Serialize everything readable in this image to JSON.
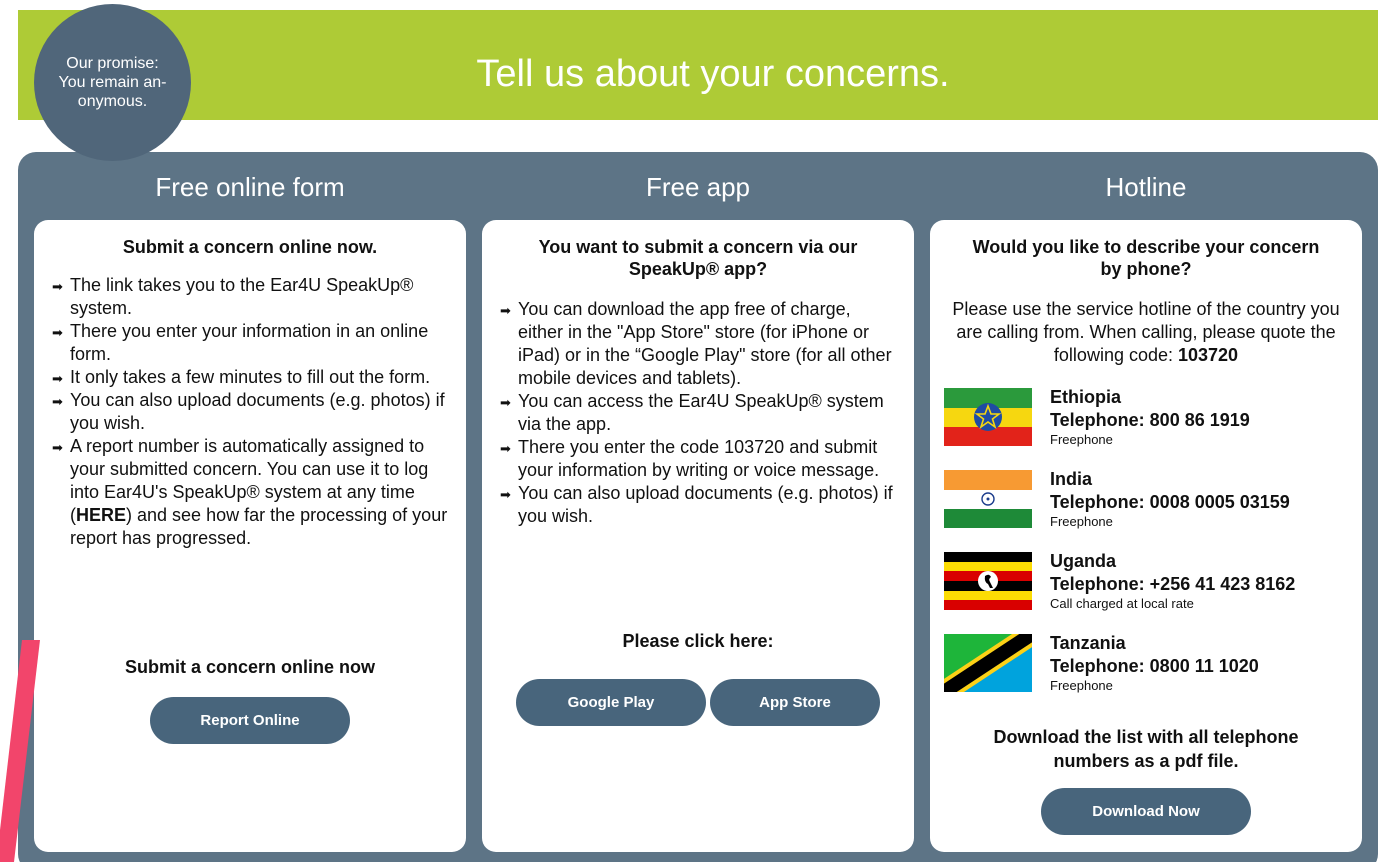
{
  "header": {
    "title": "Tell us about your concerns.",
    "promise": [
      "Our promise:",
      "You remain an-",
      "onymous."
    ]
  },
  "online_form": {
    "column_title": "Free online form",
    "heading": "Submit a concern online now.",
    "items": [
      "The link takes you to the Ear4U SpeakUp® system.",
      "There you enter your information in an online form.",
      "It only takes a few minutes to fill out the form.",
      "You can also upload documents (e.g. photos) if you wish."
    ],
    "item5_before": "A report number is automatically assigned to your submitted concern. You can use it to log into Ear4U's SpeakUp® system at any time (",
    "item5_link": "HERE",
    "item5_after": ") and see how far the processing of your report has progressed.",
    "footer_heading": "Submit a concern online now",
    "button_label": "Report Online"
  },
  "app": {
    "column_title": "Free app",
    "heading": "You want to submit a concern via our SpeakUp® app?",
    "items": [
      "You can download the app free of charge, either in the \"App Store\" store (for iPhone or iPad) or in the “Google Play\" store (for all other mobile devices and tablets).",
      "You can access the Ear4U SpeakUp® system via the app.",
      "There you enter the code 103720 and submit your information by writing or voice message.",
      "You can also upload documents (e.g. photos) if you wish."
    ],
    "cta": "Please click here:",
    "google_play_label": "Google Play",
    "app_store_label": "App Store"
  },
  "hotline": {
    "column_title": "Hotline",
    "heading": "Would you like to describe your concern by phone?",
    "intro": "Please use the service hotline of the country you are calling from. When calling, please quote the following code: ",
    "code": "103720",
    "countries": [
      {
        "name": "Ethiopia",
        "tel": "Telephone: 800 86 1919",
        "note": "Freephone"
      },
      {
        "name": "India",
        "tel": "Telephone: 0008 0005 03159",
        "note": "Freephone"
      },
      {
        "name": "Uganda",
        "tel": "Telephone: +256 41 423 8162",
        "note": "Call charged at local rate"
      },
      {
        "name": "Tanzania",
        "tel": "Telephone: 0800 11 1020",
        "note": "Freephone"
      }
    ],
    "download_text": "Download the list with all telephone numbers as a pdf file.",
    "download_button": "Download Now"
  },
  "colors": {
    "header_green": "#aecb36",
    "panel_slate": "#5d7486",
    "button_blue": "#48657c",
    "accent_pink": "#f2456b"
  }
}
